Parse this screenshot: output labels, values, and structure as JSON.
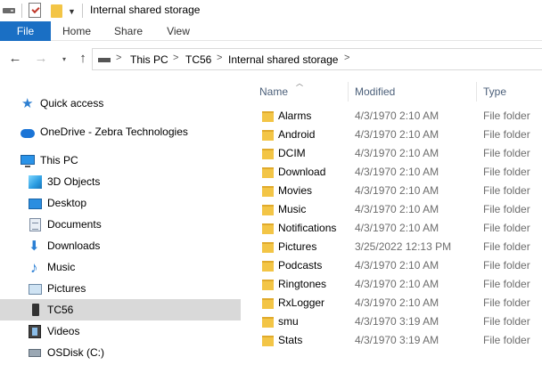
{
  "window": {
    "title": "Internal shared storage",
    "icons": [
      "drive-icon",
      "properties-check-icon",
      "new-folder-icon",
      "dropdown-icon"
    ]
  },
  "ribbon": {
    "tabs": [
      "File",
      "Home",
      "Share",
      "View"
    ],
    "file_color": "#1a6fc4"
  },
  "nav": {
    "back_glyph": "←",
    "forward_glyph": "→",
    "recent_glyph": "▾",
    "up_glyph": "↑",
    "separator": ">",
    "breadcrumbs": [
      "This PC",
      "TC56",
      "Internal shared storage"
    ]
  },
  "sidebar": {
    "items": [
      {
        "label": "Quick access",
        "icon": "star-icon"
      },
      {
        "label": "OneDrive - Zebra Technologies",
        "icon": "cloud-icon"
      },
      {
        "label": "This PC",
        "icon": "computer-icon"
      },
      {
        "label": "3D Objects",
        "icon": "cube-icon"
      },
      {
        "label": "Desktop",
        "icon": "desktop-icon"
      },
      {
        "label": "Documents",
        "icon": "document-icon"
      },
      {
        "label": "Downloads",
        "icon": "download-icon"
      },
      {
        "label": "Music",
        "icon": "music-note-icon"
      },
      {
        "label": "Pictures",
        "icon": "picture-icon"
      },
      {
        "label": "TC56",
        "icon": "mobile-device-icon",
        "selected": true
      },
      {
        "label": "Videos",
        "icon": "film-icon"
      },
      {
        "label": "OSDisk (C:)",
        "icon": "disk-icon"
      }
    ]
  },
  "columns": {
    "name": "Name",
    "modified": "Modified",
    "type": "Type"
  },
  "files": [
    {
      "name": "Alarms",
      "modified": "4/3/1970 2:10 AM",
      "type": "File folder"
    },
    {
      "name": "Android",
      "modified": "4/3/1970 2:10 AM",
      "type": "File folder"
    },
    {
      "name": "DCIM",
      "modified": "4/3/1970 2:10 AM",
      "type": "File folder"
    },
    {
      "name": "Download",
      "modified": "4/3/1970 2:10 AM",
      "type": "File folder"
    },
    {
      "name": "Movies",
      "modified": "4/3/1970 2:10 AM",
      "type": "File folder"
    },
    {
      "name": "Music",
      "modified": "4/3/1970 2:10 AM",
      "type": "File folder"
    },
    {
      "name": "Notifications",
      "modified": "4/3/1970 2:10 AM",
      "type": "File folder"
    },
    {
      "name": "Pictures",
      "modified": "3/25/2022 12:13 PM",
      "type": "File folder"
    },
    {
      "name": "Podcasts",
      "modified": "4/3/1970 2:10 AM",
      "type": "File folder"
    },
    {
      "name": "Ringtones",
      "modified": "4/3/1970 2:10 AM",
      "type": "File folder"
    },
    {
      "name": "RxLogger",
      "modified": "4/3/1970 2:10 AM",
      "type": "File folder"
    },
    {
      "name": "smu",
      "modified": "4/3/1970 3:19 AM",
      "type": "File folder"
    },
    {
      "name": "Stats",
      "modified": "4/3/1970 3:19 AM",
      "type": "File folder"
    }
  ]
}
